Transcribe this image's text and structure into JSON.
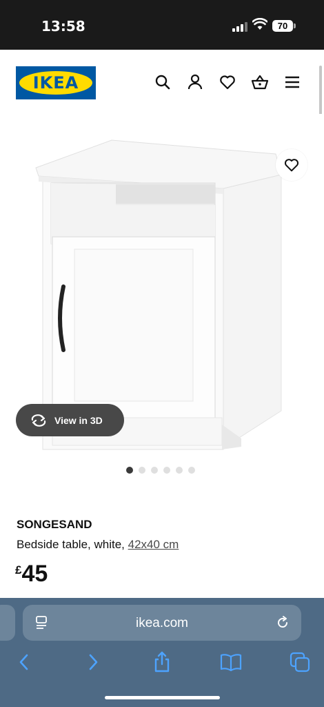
{
  "status_bar": {
    "time": "13:58",
    "battery": "70"
  },
  "header": {
    "logo_text": "IKEA",
    "icons": [
      "search-icon",
      "user-icon",
      "heart-icon",
      "basket-icon",
      "menu-icon"
    ]
  },
  "gallery": {
    "view_3d_label": "View in 3D",
    "dots_total": 6,
    "dots_active": 1
  },
  "product": {
    "name": "SONGESAND",
    "description": "Bedside table, white, ",
    "dimensions": "42x40 cm",
    "currency": "£",
    "price": "45"
  },
  "browser": {
    "url": "ikea.com",
    "toolbar_icons": [
      "back-icon",
      "forward-icon",
      "share-icon",
      "bookmarks-icon",
      "tabs-icon"
    ]
  },
  "colors": {
    "ikea_blue": "#0058a3",
    "ikea_yellow": "#ffdb00",
    "browser_bar": "#4e6a85",
    "toolbar_icon": "#4da3ff"
  }
}
